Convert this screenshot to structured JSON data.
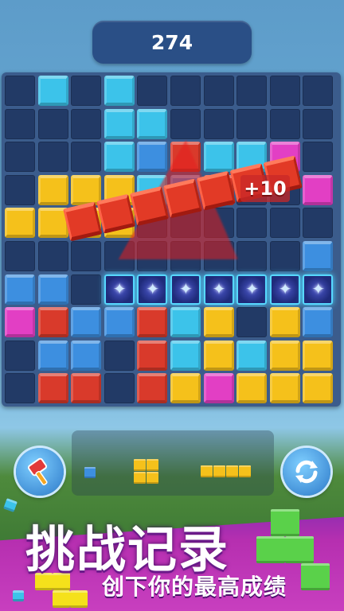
{
  "score": "274",
  "combo_popup": "+10",
  "banner": {
    "title": "挑战记录",
    "subtitle": "创下你的最高成绩"
  },
  "colors": {
    "cyan": "#3cc3ea",
    "blue": "#3d8fe0",
    "red": "#d93a2b",
    "yellow": "#f5c11b",
    "magenta": "#e23fc4",
    "board": "#223a66"
  },
  "controls": {
    "left_button_icon": "hammer-icon",
    "right_button_icon": "refresh-icon"
  },
  "next_pieces": [
    "single-blue-square",
    "yellow-2x2-square",
    "yellow-1x4-line"
  ]
}
